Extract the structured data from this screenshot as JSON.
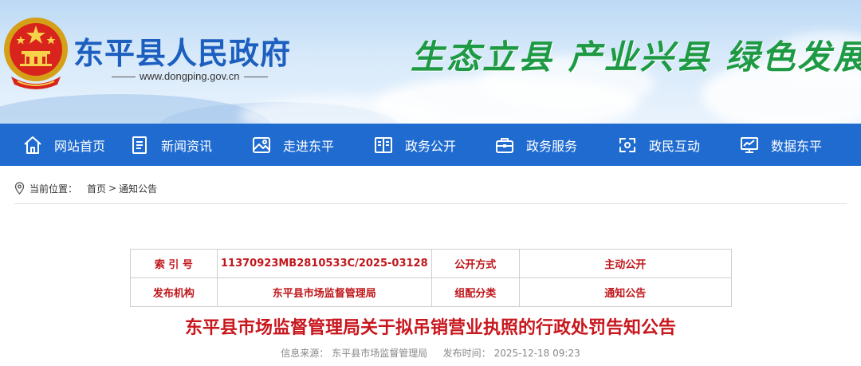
{
  "header": {
    "site_title": "东平县人民政府",
    "site_url": "www.dongping.gov.cn",
    "slogan": "生态立县 产业兴县 绿色发展"
  },
  "nav": {
    "items": [
      {
        "label": "网站首页",
        "icon": "home-icon"
      },
      {
        "label": "新闻资讯",
        "icon": "news-icon"
      },
      {
        "label": "走进东平",
        "icon": "landscape-icon"
      },
      {
        "label": "政务公开",
        "icon": "book-icon"
      },
      {
        "label": "政务服务",
        "icon": "briefcase-icon"
      },
      {
        "label": "政民互动",
        "icon": "interaction-icon"
      },
      {
        "label": "数据东平",
        "icon": "monitor-chart-icon"
      }
    ]
  },
  "breadcrumb": {
    "prefix": "当前位置：",
    "home": "首页",
    "separator": ">",
    "current": "通知公告"
  },
  "info_table": {
    "index_label": "索 引 号",
    "index_value": "11370923MB2810533C/2025-03128",
    "open_mode_label": "公开方式",
    "open_mode_value": "主动公开",
    "publisher_label": "发布机构",
    "publisher_value": "东平县市场监督管理局",
    "category_label": "组配分类",
    "category_value": "通知公告"
  },
  "article": {
    "title": "东平县市场监督管理局关于拟吊销营业执照的行政处罚告知公告",
    "source_label": "信息来源：",
    "source_value": "东平县市场监督管理局",
    "time_label": "发布时间：",
    "time_value": "2025-12-18 09:23"
  },
  "colors": {
    "nav_bg": "#1f6bd0",
    "title_blue": "#1d5fbf",
    "slogan_green": "#1d9a43",
    "accent_red": "#c8161d"
  }
}
